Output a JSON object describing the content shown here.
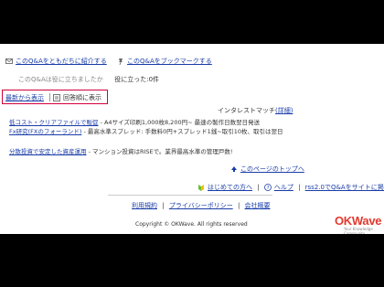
{
  "top_links": {
    "recommend_label": "このQ&Aをともだちに紹介する",
    "bookmark_label": "このQ&Aをブックマークする"
  },
  "helpful": {
    "prefix": "このQ&Aは役に立ちましたか",
    "count_text": "役に立った:0件"
  },
  "answer_tabs": {
    "newest_label": "最新から表示",
    "order_label": "回答順に表示"
  },
  "ads": {
    "header": "インタレストマッチ",
    "header_detail": "(詳細)",
    "items": [
      {
        "link": "低コスト・クリアファイルで販促",
        "desc": "- A4サイズ印刷1,000枚8,200円~ 最速の製作日数翌日発送"
      },
      {
        "link": "Fx研究(FXのフォーランド)",
        "desc": "- 最高水準スプレッド: 手数料0円+スプレッド1銭~取引10枚、取引は翌日"
      },
      {
        "link": "分散投資で安定した資産運用",
        "desc": "- マンション投資はRISEで。業界最高水準の管理戸数!"
      }
    ],
    "page_top_label": "このページのトップへ"
  },
  "footer_nav": {
    "beginner_label": "はじめての方へ",
    "help_label": "ヘルプ",
    "rss_label": "rss2.0でQ&Aをサイトに掲載"
  },
  "legal": {
    "terms_label": "利用規約",
    "privacy_label": "プライバシーポリシー",
    "company_label": "会社概要",
    "copyright": "Copyright © OKWave. All rights reserved"
  },
  "brand": {
    "logo_text": "OKWave",
    "tagline": "Your Knowledge Community"
  },
  "colors": {
    "link": "#1a3da8",
    "accent_red": "#d0003a",
    "logo_red": "#e23a2e"
  }
}
